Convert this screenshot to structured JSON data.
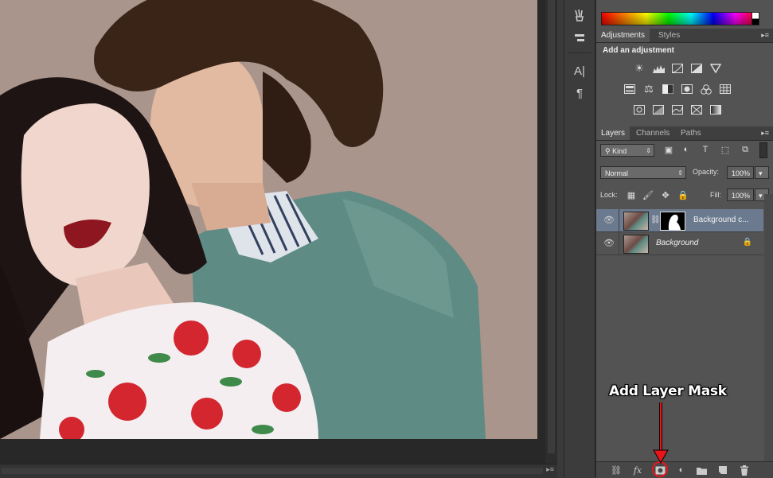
{
  "adjustments_panel": {
    "tabs": [
      "Adjustments",
      "Styles"
    ],
    "heading": "Add an adjustment",
    "icons_row1": [
      "brightness-contrast-icon",
      "levels-icon",
      "curves-icon",
      "exposure-icon",
      "vibrance-icon"
    ],
    "icons_row2": [
      "hue-saturation-icon",
      "color-balance-icon",
      "black-white-icon",
      "photo-filter-icon",
      "channel-mixer-icon",
      "color-lookup-icon"
    ],
    "icons_row3": [
      "invert-icon",
      "posterize-icon",
      "threshold-icon",
      "selective-color-icon",
      "gradient-map-icon"
    ]
  },
  "layers_panel": {
    "tabs": [
      "Layers",
      "Channels",
      "Paths"
    ],
    "filter_kind": "Kind",
    "blend_mode": "Normal",
    "opacity_label": "Opacity:",
    "opacity_value": "100%",
    "lock_label": "Lock:",
    "fill_label": "Fill:",
    "fill_value": "100%",
    "layers": [
      {
        "name": "Background c...",
        "visible": true,
        "selected": true,
        "has_mask": true
      },
      {
        "name": "Background",
        "visible": true,
        "selected": false,
        "locked": true
      }
    ],
    "footer_icons": [
      "link-layers-icon",
      "fx-icon",
      "add-layer-mask-icon",
      "new-adjustment-layer-icon",
      "new-group-icon",
      "new-layer-icon",
      "delete-layer-icon"
    ],
    "fx_label": "fx"
  },
  "annotation": {
    "label": "Add Layer Mask",
    "color": "#e8151b"
  },
  "tool_strip": {
    "type_tool_label": "A|",
    "paragraph_label": "¶"
  },
  "colors": {
    "panel_bg": "#535353",
    "selected_layer": "#6b7a8f",
    "photo_backdrop": "#a9958c"
  }
}
